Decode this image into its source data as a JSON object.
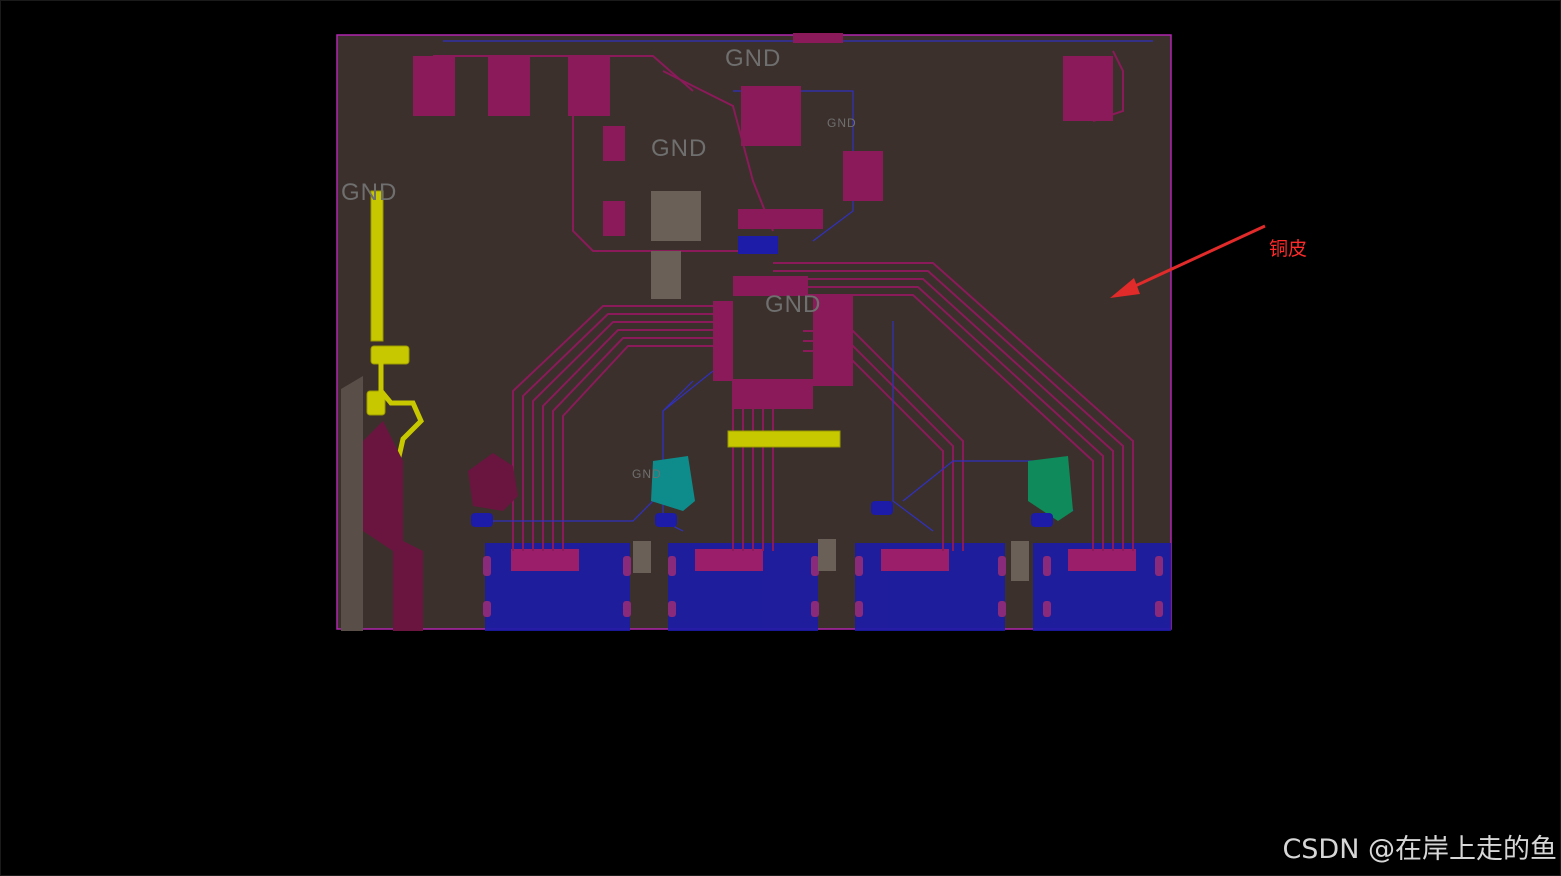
{
  "board": {
    "net_labels": [
      "GND",
      "GND",
      "GND",
      "GND",
      "GND",
      "GND"
    ]
  },
  "annotation": {
    "label": "铜皮",
    "color": "#ff2a2a"
  },
  "watermark": {
    "text": "CSDN @在岸上走的鱼"
  },
  "colors": {
    "background": "#000000",
    "copper_pour": "#3b302b",
    "outline": "#b026b0",
    "trace_top": "#8a1a5a",
    "trace_bottom": "#1c1ca8",
    "pad_highlight": "#c8c800",
    "teal_pour": "#0e8b8b",
    "green_pour": "#0f8a5a"
  }
}
